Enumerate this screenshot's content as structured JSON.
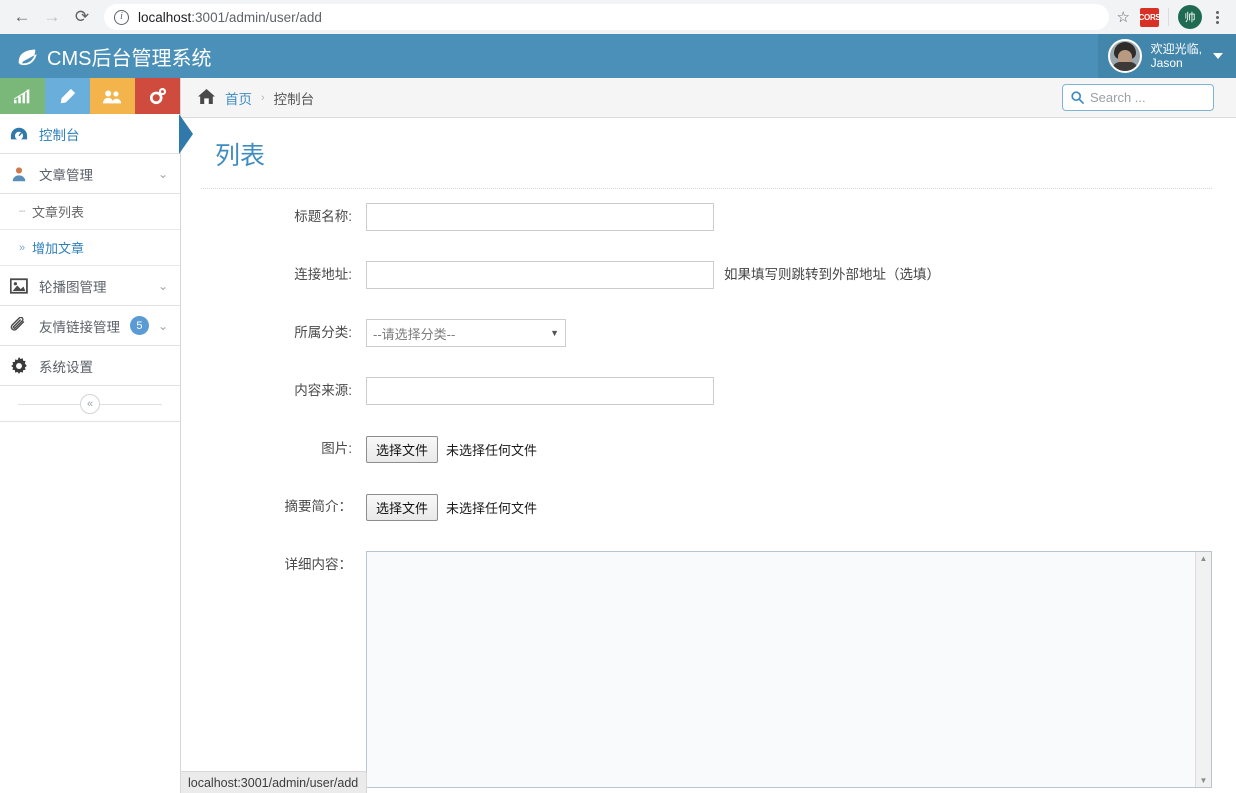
{
  "browser": {
    "back_icon": "←",
    "forward_icon": "→",
    "reload_icon": "⟳",
    "info_icon": "i",
    "url_host": "localhost",
    "url_path": ":3001/admin/user/add",
    "star_icon": "☆",
    "extension_badge": "CORS",
    "profile_initial": "帅",
    "menu_icon": "kebab-menu"
  },
  "header": {
    "logo_icon": "leaf-icon",
    "title": "CMS后台管理系统",
    "user": {
      "greeting": "欢迎光临,",
      "name": "Jason",
      "caret": "▼"
    }
  },
  "sidebar": {
    "tiles": [
      {
        "name": "stats-tile",
        "icon": "bar-chart-icon",
        "color": "#7ab87a"
      },
      {
        "name": "edit-tile",
        "icon": "pencil-icon",
        "color": "#6aaedb"
      },
      {
        "name": "users-tile",
        "icon": "users-icon",
        "color": "#f3b44c"
      },
      {
        "name": "settings-tile",
        "icon": "gears-icon",
        "color": "#cf4b3e"
      }
    ],
    "items": [
      {
        "label": "控制台",
        "icon": "dashboard-icon",
        "active": true
      },
      {
        "label": "文章管理",
        "icon": "user-group-icon",
        "chevron": "⌄"
      },
      {
        "label": "文章列表",
        "sub": true,
        "marker": "┄"
      },
      {
        "label": "增加文章",
        "sub": true,
        "marker": "»",
        "highlight": true
      },
      {
        "label": "轮播图管理",
        "icon": "image-icon",
        "chevron": "⌄"
      },
      {
        "label": "友情链接管理",
        "icon": "paperclip-icon",
        "badge": "5",
        "chevron": "⌄"
      },
      {
        "label": "系统设置",
        "icon": "gear-icon"
      }
    ],
    "collapse_icon": "«"
  },
  "topbar": {
    "home_icon": "home-icon",
    "breadcrumb": [
      {
        "label": "首页",
        "link": true
      },
      {
        "label": "控制台",
        "link": false
      }
    ],
    "separator": "›",
    "search": {
      "icon": "search-icon",
      "placeholder": "Search ..."
    }
  },
  "page": {
    "title": "列表",
    "form": [
      {
        "label": "标题名称:",
        "type": "text",
        "value": "",
        "hint": ""
      },
      {
        "label": "连接地址:",
        "type": "text",
        "value": "",
        "hint": "如果填写则跳转到外部地址（选填）"
      },
      {
        "label": "所属分类:",
        "type": "select",
        "value": "--请选择分类--",
        "arrow": "▼"
      },
      {
        "label": "内容来源:",
        "type": "text",
        "value": "",
        "hint": ""
      },
      {
        "label": "图片:",
        "type": "file",
        "button": "选择文件",
        "status": "未选择任何文件"
      },
      {
        "label": "摘要简介：",
        "type": "file",
        "button": "选择文件",
        "status": "未选择任何文件"
      },
      {
        "label": "详细内容：",
        "type": "textarea",
        "value": ""
      }
    ]
  },
  "status_bar": {
    "text": "localhost:3001/admin/user/add"
  },
  "colors": {
    "brand_blue": "#4a90b8",
    "link_blue": "#3f8dbf",
    "badge_blue": "#5b9bd5",
    "pointer_blue": "#3079ab"
  }
}
